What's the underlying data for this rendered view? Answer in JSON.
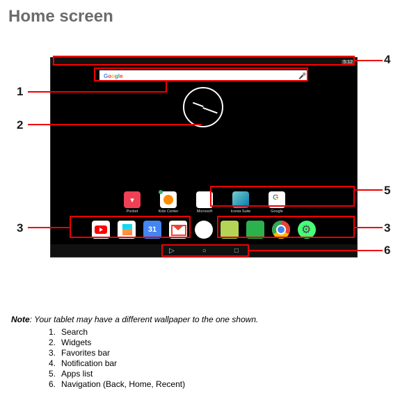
{
  "title": "Home screen",
  "status": {
    "time": "5:12"
  },
  "search": {
    "logo": "Google"
  },
  "apps_row": [
    {
      "name": "pocket",
      "label": "Pocket"
    },
    {
      "name": "kids",
      "label": "Kids Center"
    },
    {
      "name": "microsoft",
      "label": "Microsoft"
    },
    {
      "name": "iconia",
      "label": "Iconia Suite"
    },
    {
      "name": "gapp",
      "label": "Google"
    }
  ],
  "favorites": {
    "calendar_day": "31"
  },
  "nav": {
    "back": "◁",
    "home": "○",
    "recent": "□"
  },
  "callouts": {
    "n1": "1",
    "n2": "2",
    "n3": "3",
    "n3b": "3",
    "n4": "4",
    "n5": "5",
    "n6": "6"
  },
  "note": {
    "prefix": "Note",
    "body": ": Your tablet may have a different wallpaper to the one shown."
  },
  "legend": [
    {
      "n": "1.",
      "t": "Search"
    },
    {
      "n": "2.",
      "t": "Widgets"
    },
    {
      "n": "3.",
      "t": "Favorites bar"
    },
    {
      "n": "4.",
      "t": "Notification bar"
    },
    {
      "n": "5.",
      "t": "Apps list"
    },
    {
      "n": "6.",
      "t": "Navigation (Back, Home, Recent)"
    }
  ]
}
